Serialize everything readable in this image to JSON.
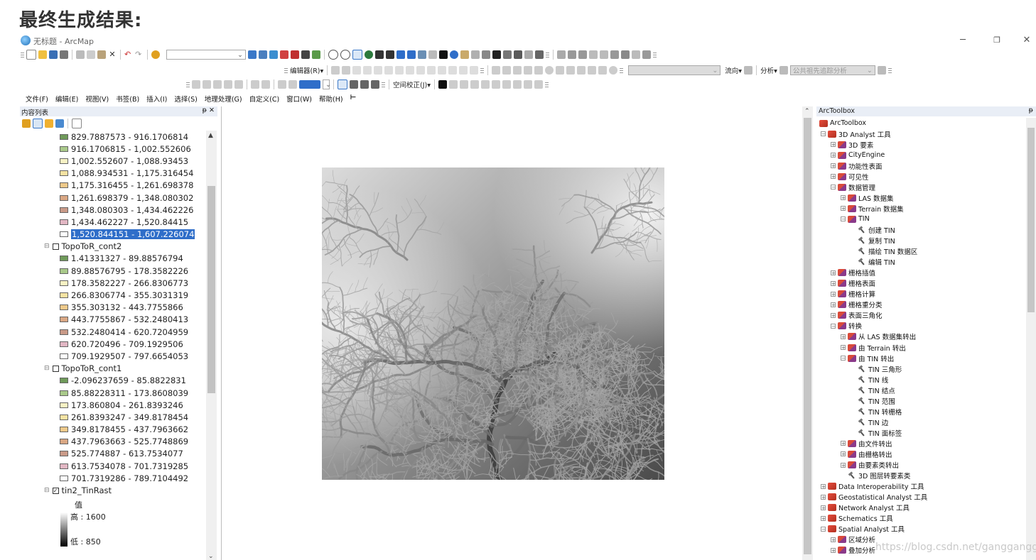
{
  "banner": "最终生成结果:",
  "window": {
    "title": "无标题 - ArcMap",
    "min": "─",
    "max": "❐",
    "close": "✕"
  },
  "toolbar": {
    "editor": "编辑器(R)▾",
    "georef": "空间校正(J)▾",
    "flow": "流向▾",
    "analysis": "分析▾",
    "trace_combo": "公共祖先追踪分析"
  },
  "menu": [
    "文件(F)",
    "编辑(E)",
    "视图(V)",
    "书签(B)",
    "插入(I)",
    "选择(S)",
    "地理处理(G)",
    "自定义(C)",
    "窗口(W)",
    "帮助(H)"
  ],
  "toc": {
    "title": "内容列表",
    "pin": "ᵽ ✕",
    "rows": [
      {
        "kind": "cls",
        "text": "829.7887573 - 916.1706814",
        "color": "#6f9a5a"
      },
      {
        "kind": "cls",
        "text": "916.1706815 - 1,002.552606",
        "color": "#a9c98a"
      },
      {
        "kind": "cls",
        "text": "1,002.552607 - 1,088.93453",
        "color": "#f7f2c4"
      },
      {
        "kind": "cls",
        "text": "1,088.934531 - 1,175.316454",
        "color": "#f5e3a3"
      },
      {
        "kind": "cls",
        "text": "1,175.316455 - 1,261.698378",
        "color": "#eec98a"
      },
      {
        "kind": "cls",
        "text": "1,261.698379 - 1,348.080302",
        "color": "#d9a784"
      },
      {
        "kind": "cls",
        "text": "1,348.080303 - 1,434.462226",
        "color": "#c99a88"
      },
      {
        "kind": "cls",
        "text": "1,434.462227 - 1,520.84415",
        "color": "#e2b7c4"
      },
      {
        "kind": "cls",
        "text": "1,520.844151 - 1,607.226074",
        "color": "#ffffff",
        "selected": true
      },
      {
        "kind": "layer",
        "text": "TopoToR_cont2",
        "expand": "⊟",
        "check": ""
      },
      {
        "kind": "cls",
        "text": "1.41331327 - 89.88576794",
        "color": "#6f9a5a"
      },
      {
        "kind": "cls",
        "text": "89.88576795 - 178.3582226",
        "color": "#a9c98a"
      },
      {
        "kind": "cls",
        "text": "178.3582227 - 266.8306773",
        "color": "#f7f2c4"
      },
      {
        "kind": "cls",
        "text": "266.8306774 - 355.3031319",
        "color": "#f5e3a3"
      },
      {
        "kind": "cls",
        "text": "355.303132 - 443.7755866",
        "color": "#eec98a"
      },
      {
        "kind": "cls",
        "text": "443.7755867 - 532.2480413",
        "color": "#d9a784"
      },
      {
        "kind": "cls",
        "text": "532.2480414 - 620.7204959",
        "color": "#c99a88"
      },
      {
        "kind": "cls",
        "text": "620.720496 - 709.1929506",
        "color": "#e2b7c4"
      },
      {
        "kind": "cls",
        "text": "709.1929507 - 797.6654053",
        "color": "#ffffff"
      },
      {
        "kind": "layer",
        "text": "TopoToR_cont1",
        "expand": "⊟",
        "check": ""
      },
      {
        "kind": "cls",
        "text": "-2.096237659 - 85.8822831",
        "color": "#6f9a5a"
      },
      {
        "kind": "cls",
        "text": "85.88228311 - 173.8608039",
        "color": "#a9c98a"
      },
      {
        "kind": "cls",
        "text": "173.860804 - 261.8393246",
        "color": "#f7f2c4"
      },
      {
        "kind": "cls",
        "text": "261.8393247 - 349.8178454",
        "color": "#f5e3a3"
      },
      {
        "kind": "cls",
        "text": "349.8178455 - 437.7963662",
        "color": "#eec98a"
      },
      {
        "kind": "cls",
        "text": "437.7963663 - 525.7748869",
        "color": "#d9a784"
      },
      {
        "kind": "cls",
        "text": "525.774887 - 613.7534077",
        "color": "#c99a88"
      },
      {
        "kind": "cls",
        "text": "613.7534078 - 701.7319285",
        "color": "#e2b7c4"
      },
      {
        "kind": "cls",
        "text": "701.7319286 - 789.7104492",
        "color": "#ffffff"
      },
      {
        "kind": "layer",
        "text": "tin2_TinRast",
        "expand": "⊟",
        "check": "✓"
      }
    ],
    "legend": {
      "value_label": "值",
      "high": "高 : 1600",
      "low": "低 : 850"
    }
  },
  "toolbox": {
    "title": "ArcToolbox",
    "pin": "ᵽ",
    "rows": [
      {
        "lvl": 0,
        "exp": "",
        "icon": "tbx",
        "text": "ArcToolbox"
      },
      {
        "lvl": 1,
        "exp": "−",
        "icon": "tbx",
        "text": "3D Analyst 工具"
      },
      {
        "lvl": 2,
        "exp": "+",
        "icon": "tset",
        "text": "3D 要素"
      },
      {
        "lvl": 2,
        "exp": "+",
        "icon": "tset",
        "text": "CityEngine"
      },
      {
        "lvl": 2,
        "exp": "+",
        "icon": "tset",
        "text": "功能性表面"
      },
      {
        "lvl": 2,
        "exp": "+",
        "icon": "tset",
        "text": "可见性"
      },
      {
        "lvl": 2,
        "exp": "−",
        "icon": "tset",
        "text": "数据管理"
      },
      {
        "lvl": 3,
        "exp": "+",
        "icon": "tset",
        "text": "LAS 数据集"
      },
      {
        "lvl": 3,
        "exp": "+",
        "icon": "tset",
        "text": "Terrain 数据集"
      },
      {
        "lvl": 3,
        "exp": "−",
        "icon": "tset",
        "text": "TIN"
      },
      {
        "lvl": 4,
        "exp": "",
        "icon": "tool",
        "text": "创建 TIN"
      },
      {
        "lvl": 4,
        "exp": "",
        "icon": "tool",
        "text": "复制 TIN"
      },
      {
        "lvl": 4,
        "exp": "",
        "icon": "tool",
        "text": "描绘 TIN 数据区"
      },
      {
        "lvl": 4,
        "exp": "",
        "icon": "tool",
        "text": "编辑 TIN"
      },
      {
        "lvl": 2,
        "exp": "+",
        "icon": "tset",
        "text": "栅格插值"
      },
      {
        "lvl": 2,
        "exp": "+",
        "icon": "tset",
        "text": "栅格表面"
      },
      {
        "lvl": 2,
        "exp": "+",
        "icon": "tset",
        "text": "栅格计算"
      },
      {
        "lvl": 2,
        "exp": "+",
        "icon": "tset",
        "text": "栅格重分类"
      },
      {
        "lvl": 2,
        "exp": "+",
        "icon": "tset",
        "text": "表面三角化"
      },
      {
        "lvl": 2,
        "exp": "−",
        "icon": "tset",
        "text": "转换"
      },
      {
        "lvl": 3,
        "exp": "+",
        "icon": "tset",
        "text": "从 LAS 数据集转出"
      },
      {
        "lvl": 3,
        "exp": "+",
        "icon": "tset",
        "text": "由 Terrain 转出"
      },
      {
        "lvl": 3,
        "exp": "−",
        "icon": "tset",
        "text": "由 TIN 转出"
      },
      {
        "lvl": 4,
        "exp": "",
        "icon": "tool",
        "text": "TIN 三角形"
      },
      {
        "lvl": 4,
        "exp": "",
        "icon": "tool",
        "text": "TIN 线"
      },
      {
        "lvl": 4,
        "exp": "",
        "icon": "tool",
        "text": "TIN 结点"
      },
      {
        "lvl": 4,
        "exp": "",
        "icon": "tool",
        "text": "TIN 范围"
      },
      {
        "lvl": 4,
        "exp": "",
        "icon": "tool",
        "text": "TIN 转栅格"
      },
      {
        "lvl": 4,
        "exp": "",
        "icon": "tool",
        "text": "TIN 边"
      },
      {
        "lvl": 4,
        "exp": "",
        "icon": "tool",
        "text": "TIN 面标签"
      },
      {
        "lvl": 3,
        "exp": "+",
        "icon": "tset",
        "text": "由文件转出"
      },
      {
        "lvl": 3,
        "exp": "+",
        "icon": "tset",
        "text": "由栅格转出"
      },
      {
        "lvl": 3,
        "exp": "+",
        "icon": "tset",
        "text": "由要素类转出"
      },
      {
        "lvl": 3,
        "exp": "",
        "icon": "tool",
        "text": "3D 图层转要素类"
      },
      {
        "lvl": 1,
        "exp": "+",
        "icon": "tbx",
        "text": "Data Interoperability 工具"
      },
      {
        "lvl": 1,
        "exp": "+",
        "icon": "tbx",
        "text": "Geostatistical Analyst 工具"
      },
      {
        "lvl": 1,
        "exp": "+",
        "icon": "tbx",
        "text": "Network Analyst 工具"
      },
      {
        "lvl": 1,
        "exp": "+",
        "icon": "tbx",
        "text": "Schematics 工具"
      },
      {
        "lvl": 1,
        "exp": "−",
        "icon": "tbx",
        "text": "Spatial Analyst 工具"
      },
      {
        "lvl": 2,
        "exp": "+",
        "icon": "tset",
        "text": "区域分析"
      },
      {
        "lvl": 2,
        "exp": "+",
        "icon": "tset",
        "text": "叠加分析"
      }
    ]
  },
  "watermark": "https://blog.csdn.net/ganggangggood"
}
